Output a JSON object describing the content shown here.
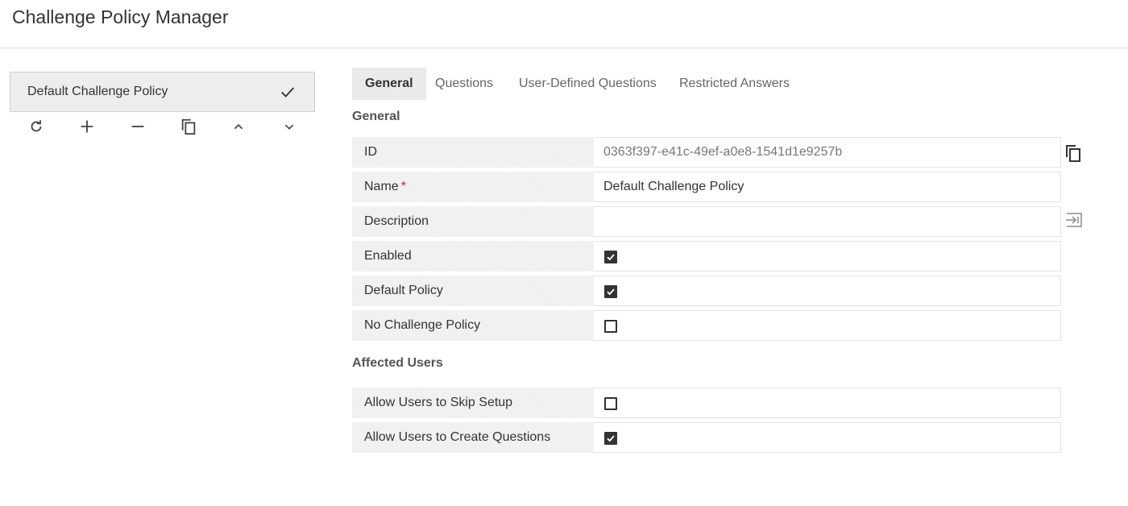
{
  "page": {
    "title": "Challenge Policy Manager"
  },
  "sidebar": {
    "policies": [
      {
        "label": "Default Challenge Policy",
        "selected": true
      }
    ],
    "toolbar_icons": [
      "refresh-icon",
      "add-icon",
      "remove-icon",
      "copy-icon",
      "move-up-icon",
      "move-down-icon"
    ]
  },
  "tabs": [
    {
      "label": "General",
      "active": true
    },
    {
      "label": "Questions",
      "active": false
    },
    {
      "label": "User-Defined Questions",
      "active": false
    },
    {
      "label": "Restricted Answers",
      "active": false
    }
  ],
  "general": {
    "section_title": "General",
    "id": {
      "label": "ID",
      "value": "0363f397-e41c-49ef-a0e8-1541d1e9257b"
    },
    "name": {
      "label": "Name",
      "required_mark": "*",
      "value": "Default Challenge Policy"
    },
    "description": {
      "label": "Description",
      "value": ""
    },
    "enabled": {
      "label": "Enabled",
      "checked": true
    },
    "default_policy": {
      "label": "Default Policy",
      "checked": true
    },
    "no_challenge_policy": {
      "label": "No Challenge Policy",
      "checked": false
    }
  },
  "affected_users": {
    "section_title": "Affected Users",
    "allow_skip_setup": {
      "label": "Allow Users to Skip Setup",
      "checked": false
    },
    "allow_create_questions": {
      "label": "Allow Users to Create Questions",
      "checked": true
    }
  },
  "colors": {
    "checkbox": "#333333",
    "required": "#dd2222",
    "label_bg": "#eeefef",
    "tab_active_bg": "#e9eaeb"
  }
}
